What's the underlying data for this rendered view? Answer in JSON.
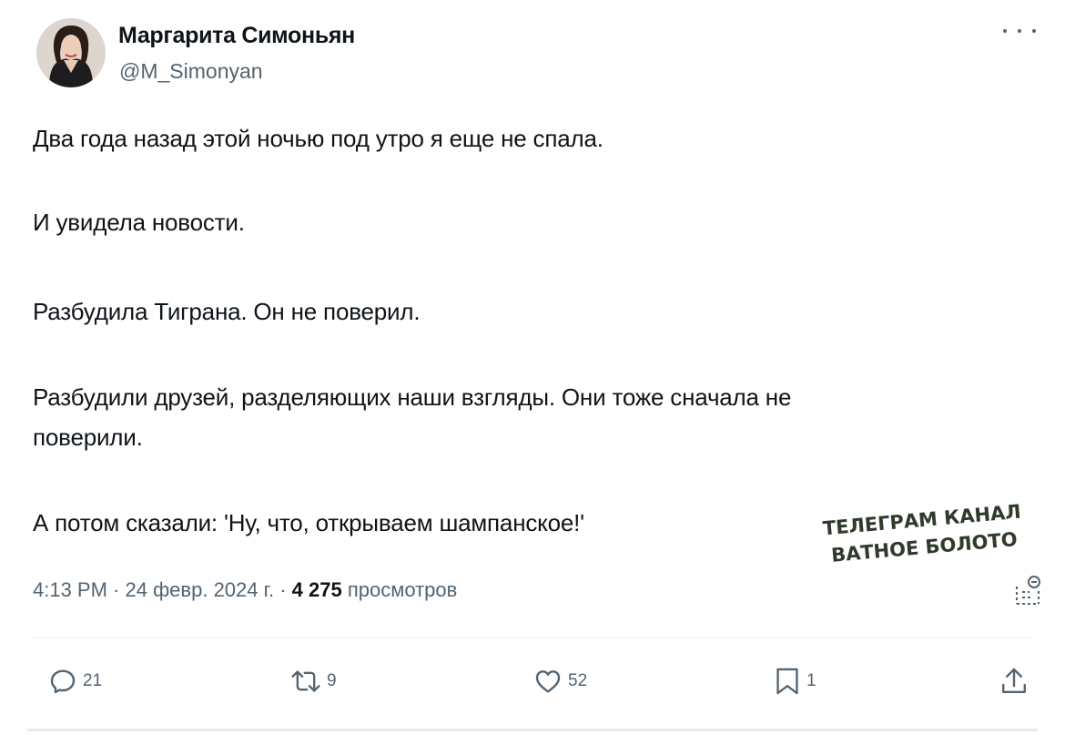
{
  "author": {
    "name": "Маргарита Симоньян",
    "handle": "@M_Simonyan"
  },
  "tweet": {
    "paragraphs": [
      "Два года назад этой ночью под утро я еще не спала.",
      "И увидела новости.",
      "Разбудила Тиграна. Он не поверил.",
      "Разбудили друзей, разделяющих наши взгляды. Они тоже сначала не",
      "поверили.",
      "А потом сказали: 'Ну, что, открываем шампанское!'"
    ]
  },
  "meta": {
    "time": "4:13 PM",
    "sep1": " · ",
    "date": "24 февр. 2024 г.",
    "sep2": " · ",
    "views_count": "4 275",
    "views_label": " просмотров"
  },
  "actions": {
    "replies": "21",
    "reposts": "9",
    "likes": "52",
    "bookmarks": "1"
  },
  "watermark": {
    "line1": "ТЕЛЕГРАМ КАНАЛ",
    "line2": "ВАТНОЕ БОЛОТО"
  },
  "icons": {
    "more": "more-icon",
    "analytics": "analytics-icon",
    "reply": "reply-icon",
    "repost": "repost-icon",
    "like": "like-icon",
    "bookmark": "bookmark-icon",
    "share": "share-icon"
  },
  "colors": {
    "text": "#0f1419",
    "secondary": "#536471",
    "divider": "#eff3f4",
    "watermark_fill": "#2f3b2a",
    "watermark_stroke": "#ffffff"
  }
}
